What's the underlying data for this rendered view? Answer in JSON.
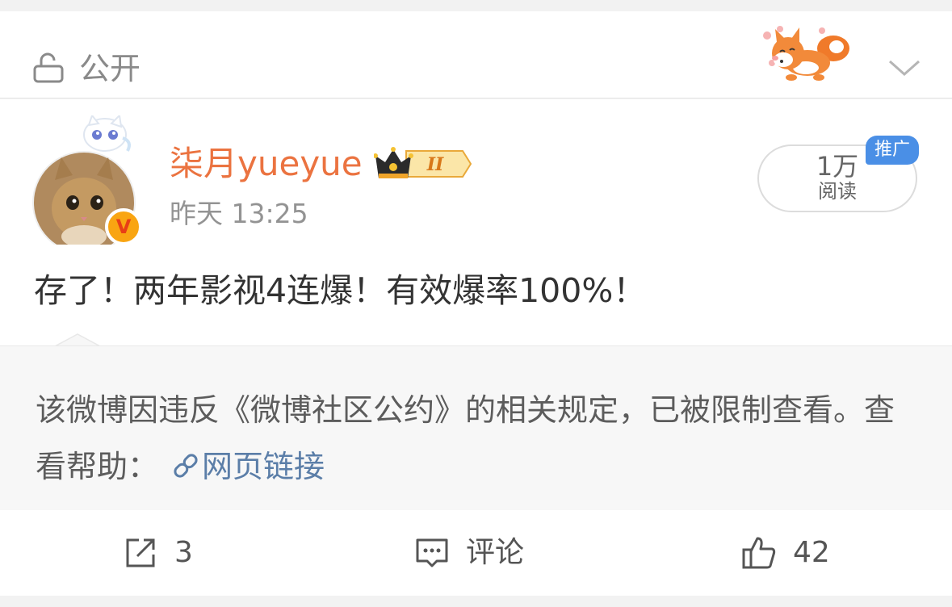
{
  "visibility": {
    "label": "公开"
  },
  "post": {
    "username": "柒月yueyue",
    "crown_level": "II",
    "verified_mark": "V",
    "timestamp": "昨天 13:25",
    "reads": {
      "count": "1万",
      "label": "阅读"
    },
    "promo_tag": "推广",
    "text": "存了！两年影视4连爆！有效爆率100%！"
  },
  "notice": {
    "text": "该微博因违反《微博社区公约》的相关规定，已被限制查看。查看帮助：",
    "link_text": "网页链接"
  },
  "actions": {
    "repost_count": "3",
    "comment_label": "评论",
    "like_count": "42"
  },
  "icons": {
    "lock": "lock-icon",
    "chevron": "chevron-down-icon",
    "link": "link-icon",
    "repost": "share-icon",
    "comment": "comment-icon",
    "like": "thumbs-up-icon"
  },
  "colors": {
    "username": "#eb7340",
    "link": "#5b7ea8",
    "promo": "#4a8fe6",
    "badge": "#f9a512"
  }
}
